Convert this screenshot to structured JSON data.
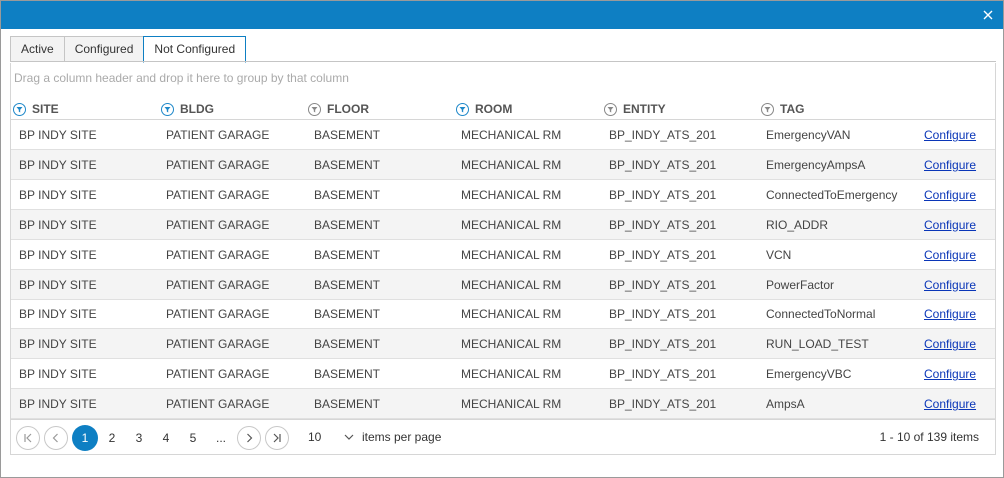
{
  "colors": {
    "titlebar": "#0e7fc3",
    "link": "#0a36b8",
    "active_page": "#0e7fc3"
  },
  "dialog": {
    "close_icon": "close-icon"
  },
  "tabs": [
    {
      "label": "Active"
    },
    {
      "label": "Configured"
    },
    {
      "label": "Not Configured"
    }
  ],
  "grid": {
    "group_hint": "Drag a column header and drop it here to group by that column",
    "columns": [
      {
        "label": "SITE"
      },
      {
        "label": "BLDG"
      },
      {
        "label": "FLOOR"
      },
      {
        "label": "ROOM"
      },
      {
        "label": "ENTITY"
      },
      {
        "label": "TAG"
      }
    ],
    "action_label": "Configure",
    "rows": [
      {
        "site": "BP INDY SITE",
        "bldg": "PATIENT GARAGE",
        "floor": "BASEMENT",
        "room": "MECHANICAL RM",
        "entity": "BP_INDY_ATS_201",
        "tag": "EmergencyVAN"
      },
      {
        "site": "BP INDY SITE",
        "bldg": "PATIENT GARAGE",
        "floor": "BASEMENT",
        "room": "MECHANICAL RM",
        "entity": "BP_INDY_ATS_201",
        "tag": "EmergencyAmpsA"
      },
      {
        "site": "BP INDY SITE",
        "bldg": "PATIENT GARAGE",
        "floor": "BASEMENT",
        "room": "MECHANICAL RM",
        "entity": "BP_INDY_ATS_201",
        "tag": "ConnectedToEmergency"
      },
      {
        "site": "BP INDY SITE",
        "bldg": "PATIENT GARAGE",
        "floor": "BASEMENT",
        "room": "MECHANICAL RM",
        "entity": "BP_INDY_ATS_201",
        "tag": "RIO_ADDR"
      },
      {
        "site": "BP INDY SITE",
        "bldg": "PATIENT GARAGE",
        "floor": "BASEMENT",
        "room": "MECHANICAL RM",
        "entity": "BP_INDY_ATS_201",
        "tag": "VCN"
      },
      {
        "site": "BP INDY SITE",
        "bldg": "PATIENT GARAGE",
        "floor": "BASEMENT",
        "room": "MECHANICAL RM",
        "entity": "BP_INDY_ATS_201",
        "tag": "PowerFactor"
      },
      {
        "site": "BP INDY SITE",
        "bldg": "PATIENT GARAGE",
        "floor": "BASEMENT",
        "room": "MECHANICAL RM",
        "entity": "BP_INDY_ATS_201",
        "tag": "ConnectedToNormal"
      },
      {
        "site": "BP INDY SITE",
        "bldg": "PATIENT GARAGE",
        "floor": "BASEMENT",
        "room": "MECHANICAL RM",
        "entity": "BP_INDY_ATS_201",
        "tag": "RUN_LOAD_TEST"
      },
      {
        "site": "BP INDY SITE",
        "bldg": "PATIENT GARAGE",
        "floor": "BASEMENT",
        "room": "MECHANICAL RM",
        "entity": "BP_INDY_ATS_201",
        "tag": "EmergencyVBC"
      },
      {
        "site": "BP INDY SITE",
        "bldg": "PATIENT GARAGE",
        "floor": "BASEMENT",
        "room": "MECHANICAL RM",
        "entity": "BP_INDY_ATS_201",
        "tag": "AmpsA"
      }
    ]
  },
  "pager": {
    "pages": [
      "1",
      "2",
      "3",
      "4",
      "5",
      "..."
    ],
    "current_page": "1",
    "page_size": "10",
    "per_page_label": "items per page",
    "info": "1 - 10 of 139 items"
  }
}
